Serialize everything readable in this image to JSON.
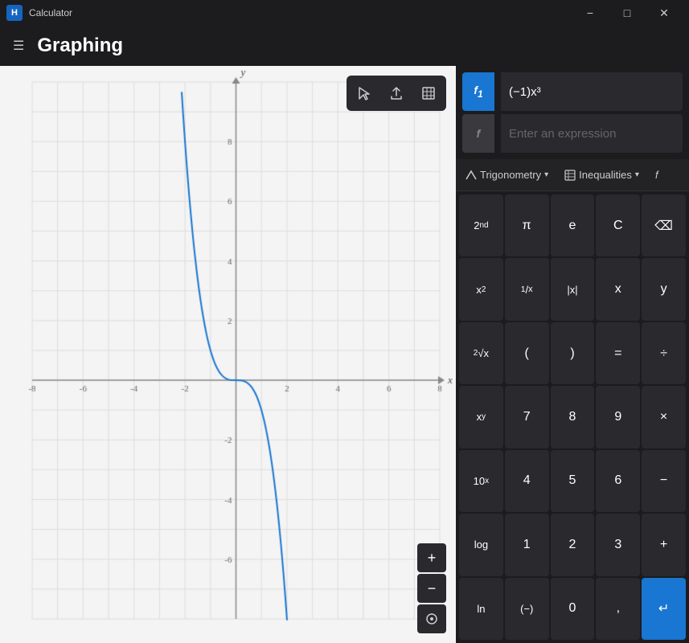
{
  "titleBar": {
    "appIcon": "H",
    "title": "Calculator",
    "minimizeLabel": "−",
    "maximizeLabel": "□",
    "closeLabel": "✕"
  },
  "header": {
    "hamburgerIcon": "☰",
    "title": "Graphing"
  },
  "graph": {
    "xMin": -8,
    "xMax": 8,
    "yMin": -8,
    "yMax": 10,
    "xLabel": "x",
    "yLabel": "y",
    "xTicks": [
      -8,
      -6,
      -4,
      -2,
      2,
      4,
      6,
      8
    ],
    "yTicks": [
      -6,
      -4,
      -2,
      2,
      4,
      6,
      8
    ],
    "curveColor": "#1976D2"
  },
  "graphToolbar": {
    "pointerIcon": "▷",
    "shareIcon": "⇪",
    "tableIcon": "⊞"
  },
  "expressions": [
    {
      "id": "f1",
      "label": "f₁",
      "value": "(−1)x³",
      "active": true,
      "color": "#1976D2"
    },
    {
      "id": "f2",
      "label": "f",
      "placeholder": "Enter an expression",
      "active": false,
      "value": ""
    }
  ],
  "funcTabs": [
    {
      "icon": "△",
      "label": "Trigonometry",
      "hasChevron": true
    },
    {
      "icon": "□",
      "label": "Inequalities",
      "hasChevron": true
    },
    {
      "icon": "f",
      "label": "",
      "hasChevron": false
    }
  ],
  "calculator": {
    "rows": [
      [
        {
          "label": "2ⁿᵈ",
          "type": "special"
        },
        {
          "label": "π",
          "type": "normal"
        },
        {
          "label": "e",
          "type": "normal"
        },
        {
          "label": "C",
          "type": "normal"
        },
        {
          "label": "⌫",
          "type": "normal"
        }
      ],
      [
        {
          "label": "x²",
          "type": "special"
        },
        {
          "label": "¹/ₓ",
          "type": "special"
        },
        {
          "label": "|x|",
          "type": "special"
        },
        {
          "label": "x",
          "type": "normal"
        },
        {
          "label": "y",
          "type": "normal"
        }
      ],
      [
        {
          "label": "ˢ√x",
          "type": "special"
        },
        {
          "label": "(",
          "type": "normal"
        },
        {
          "label": ")",
          "type": "normal"
        },
        {
          "label": "=",
          "type": "normal"
        },
        {
          "label": "÷",
          "type": "normal"
        }
      ],
      [
        {
          "label": "xʸ",
          "type": "special"
        },
        {
          "label": "7",
          "type": "normal"
        },
        {
          "label": "8",
          "type": "normal"
        },
        {
          "label": "9",
          "type": "normal"
        },
        {
          "label": "×",
          "type": "normal"
        }
      ],
      [
        {
          "label": "10ˣ",
          "type": "special"
        },
        {
          "label": "4",
          "type": "normal"
        },
        {
          "label": "5",
          "type": "normal"
        },
        {
          "label": "6",
          "type": "normal"
        },
        {
          "label": "−",
          "type": "normal"
        }
      ],
      [
        {
          "label": "log",
          "type": "special"
        },
        {
          "label": "1",
          "type": "normal"
        },
        {
          "label": "2",
          "type": "normal"
        },
        {
          "label": "3",
          "type": "normal"
        },
        {
          "label": "+",
          "type": "normal"
        }
      ],
      [
        {
          "label": "ln",
          "type": "special"
        },
        {
          "label": "(−)",
          "type": "special"
        },
        {
          "label": "0",
          "type": "normal"
        },
        {
          "label": ",",
          "type": "normal"
        },
        {
          "label": "↵",
          "type": "accent"
        }
      ]
    ]
  },
  "zoomControls": {
    "plusLabel": "+",
    "minusLabel": "−",
    "resetLabel": "⊙"
  }
}
